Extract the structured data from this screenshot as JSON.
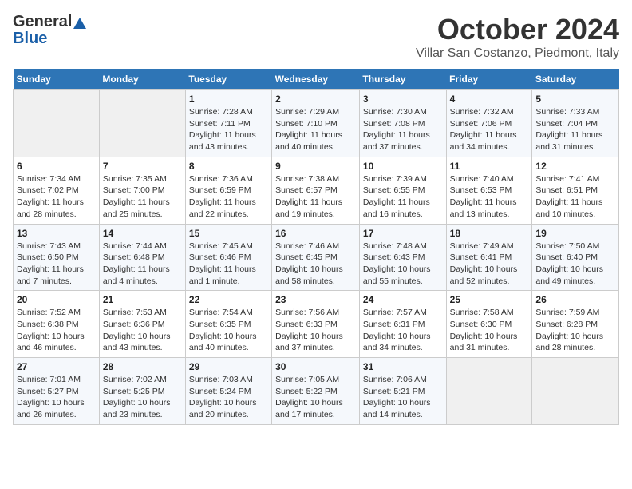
{
  "header": {
    "logo_general": "General",
    "logo_blue": "Blue",
    "month": "October 2024",
    "location": "Villar San Costanzo, Piedmont, Italy"
  },
  "days_of_week": [
    "Sunday",
    "Monday",
    "Tuesday",
    "Wednesday",
    "Thursday",
    "Friday",
    "Saturday"
  ],
  "weeks": [
    [
      {
        "day": "",
        "sunrise": "",
        "sunset": "",
        "daylight": "",
        "empty": true
      },
      {
        "day": "",
        "sunrise": "",
        "sunset": "",
        "daylight": "",
        "empty": true
      },
      {
        "day": "1",
        "sunrise": "Sunrise: 7:28 AM",
        "sunset": "Sunset: 7:11 PM",
        "daylight": "Daylight: 11 hours and 43 minutes."
      },
      {
        "day": "2",
        "sunrise": "Sunrise: 7:29 AM",
        "sunset": "Sunset: 7:10 PM",
        "daylight": "Daylight: 11 hours and 40 minutes."
      },
      {
        "day": "3",
        "sunrise": "Sunrise: 7:30 AM",
        "sunset": "Sunset: 7:08 PM",
        "daylight": "Daylight: 11 hours and 37 minutes."
      },
      {
        "day": "4",
        "sunrise": "Sunrise: 7:32 AM",
        "sunset": "Sunset: 7:06 PM",
        "daylight": "Daylight: 11 hours and 34 minutes."
      },
      {
        "day": "5",
        "sunrise": "Sunrise: 7:33 AM",
        "sunset": "Sunset: 7:04 PM",
        "daylight": "Daylight: 11 hours and 31 minutes."
      }
    ],
    [
      {
        "day": "6",
        "sunrise": "Sunrise: 7:34 AM",
        "sunset": "Sunset: 7:02 PM",
        "daylight": "Daylight: 11 hours and 28 minutes."
      },
      {
        "day": "7",
        "sunrise": "Sunrise: 7:35 AM",
        "sunset": "Sunset: 7:00 PM",
        "daylight": "Daylight: 11 hours and 25 minutes."
      },
      {
        "day": "8",
        "sunrise": "Sunrise: 7:36 AM",
        "sunset": "Sunset: 6:59 PM",
        "daylight": "Daylight: 11 hours and 22 minutes."
      },
      {
        "day": "9",
        "sunrise": "Sunrise: 7:38 AM",
        "sunset": "Sunset: 6:57 PM",
        "daylight": "Daylight: 11 hours and 19 minutes."
      },
      {
        "day": "10",
        "sunrise": "Sunrise: 7:39 AM",
        "sunset": "Sunset: 6:55 PM",
        "daylight": "Daylight: 11 hours and 16 minutes."
      },
      {
        "day": "11",
        "sunrise": "Sunrise: 7:40 AM",
        "sunset": "Sunset: 6:53 PM",
        "daylight": "Daylight: 11 hours and 13 minutes."
      },
      {
        "day": "12",
        "sunrise": "Sunrise: 7:41 AM",
        "sunset": "Sunset: 6:51 PM",
        "daylight": "Daylight: 11 hours and 10 minutes."
      }
    ],
    [
      {
        "day": "13",
        "sunrise": "Sunrise: 7:43 AM",
        "sunset": "Sunset: 6:50 PM",
        "daylight": "Daylight: 11 hours and 7 minutes."
      },
      {
        "day": "14",
        "sunrise": "Sunrise: 7:44 AM",
        "sunset": "Sunset: 6:48 PM",
        "daylight": "Daylight: 11 hours and 4 minutes."
      },
      {
        "day": "15",
        "sunrise": "Sunrise: 7:45 AM",
        "sunset": "Sunset: 6:46 PM",
        "daylight": "Daylight: 11 hours and 1 minute."
      },
      {
        "day": "16",
        "sunrise": "Sunrise: 7:46 AM",
        "sunset": "Sunset: 6:45 PM",
        "daylight": "Daylight: 10 hours and 58 minutes."
      },
      {
        "day": "17",
        "sunrise": "Sunrise: 7:48 AM",
        "sunset": "Sunset: 6:43 PM",
        "daylight": "Daylight: 10 hours and 55 minutes."
      },
      {
        "day": "18",
        "sunrise": "Sunrise: 7:49 AM",
        "sunset": "Sunset: 6:41 PM",
        "daylight": "Daylight: 10 hours and 52 minutes."
      },
      {
        "day": "19",
        "sunrise": "Sunrise: 7:50 AM",
        "sunset": "Sunset: 6:40 PM",
        "daylight": "Daylight: 10 hours and 49 minutes."
      }
    ],
    [
      {
        "day": "20",
        "sunrise": "Sunrise: 7:52 AM",
        "sunset": "Sunset: 6:38 PM",
        "daylight": "Daylight: 10 hours and 46 minutes."
      },
      {
        "day": "21",
        "sunrise": "Sunrise: 7:53 AM",
        "sunset": "Sunset: 6:36 PM",
        "daylight": "Daylight: 10 hours and 43 minutes."
      },
      {
        "day": "22",
        "sunrise": "Sunrise: 7:54 AM",
        "sunset": "Sunset: 6:35 PM",
        "daylight": "Daylight: 10 hours and 40 minutes."
      },
      {
        "day": "23",
        "sunrise": "Sunrise: 7:56 AM",
        "sunset": "Sunset: 6:33 PM",
        "daylight": "Daylight: 10 hours and 37 minutes."
      },
      {
        "day": "24",
        "sunrise": "Sunrise: 7:57 AM",
        "sunset": "Sunset: 6:31 PM",
        "daylight": "Daylight: 10 hours and 34 minutes."
      },
      {
        "day": "25",
        "sunrise": "Sunrise: 7:58 AM",
        "sunset": "Sunset: 6:30 PM",
        "daylight": "Daylight: 10 hours and 31 minutes."
      },
      {
        "day": "26",
        "sunrise": "Sunrise: 7:59 AM",
        "sunset": "Sunset: 6:28 PM",
        "daylight": "Daylight: 10 hours and 28 minutes."
      }
    ],
    [
      {
        "day": "27",
        "sunrise": "Sunrise: 7:01 AM",
        "sunset": "Sunset: 5:27 PM",
        "daylight": "Daylight: 10 hours and 26 minutes."
      },
      {
        "day": "28",
        "sunrise": "Sunrise: 7:02 AM",
        "sunset": "Sunset: 5:25 PM",
        "daylight": "Daylight: 10 hours and 23 minutes."
      },
      {
        "day": "29",
        "sunrise": "Sunrise: 7:03 AM",
        "sunset": "Sunset: 5:24 PM",
        "daylight": "Daylight: 10 hours and 20 minutes."
      },
      {
        "day": "30",
        "sunrise": "Sunrise: 7:05 AM",
        "sunset": "Sunset: 5:22 PM",
        "daylight": "Daylight: 10 hours and 17 minutes."
      },
      {
        "day": "31",
        "sunrise": "Sunrise: 7:06 AM",
        "sunset": "Sunset: 5:21 PM",
        "daylight": "Daylight: 10 hours and 14 minutes."
      },
      {
        "day": "",
        "sunrise": "",
        "sunset": "",
        "daylight": "",
        "empty": true
      },
      {
        "day": "",
        "sunrise": "",
        "sunset": "",
        "daylight": "",
        "empty": true
      }
    ]
  ]
}
